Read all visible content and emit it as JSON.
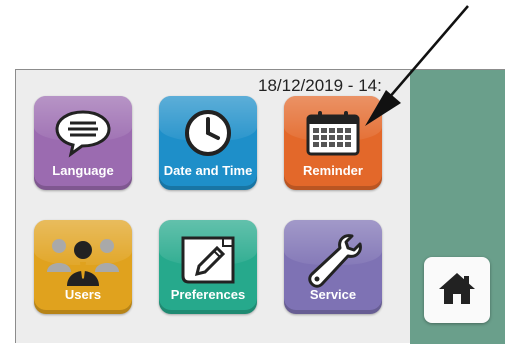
{
  "status": {
    "datetime": "18/12/2019 - 14:"
  },
  "tiles": [
    {
      "label": "Language",
      "icon": "speech-bubble-icon",
      "color": "#9b6bb0"
    },
    {
      "label": "Date and Time",
      "icon": "clock-icon",
      "color": "#1e8fc9"
    },
    {
      "label": "Reminder",
      "icon": "calendar-icon",
      "color": "#e3682a"
    },
    {
      "label": "Users",
      "icon": "users-icon",
      "color": "#e0a21e"
    },
    {
      "label": "Preferences",
      "icon": "pencil-note-icon",
      "color": "#26a98c"
    },
    {
      "label": "Service",
      "icon": "wrench-icon",
      "color": "#7e72b4"
    }
  ],
  "home": {
    "icon": "home-icon"
  },
  "colors": {
    "sidebar": "#6a9f8b",
    "screen": "#ededed"
  }
}
